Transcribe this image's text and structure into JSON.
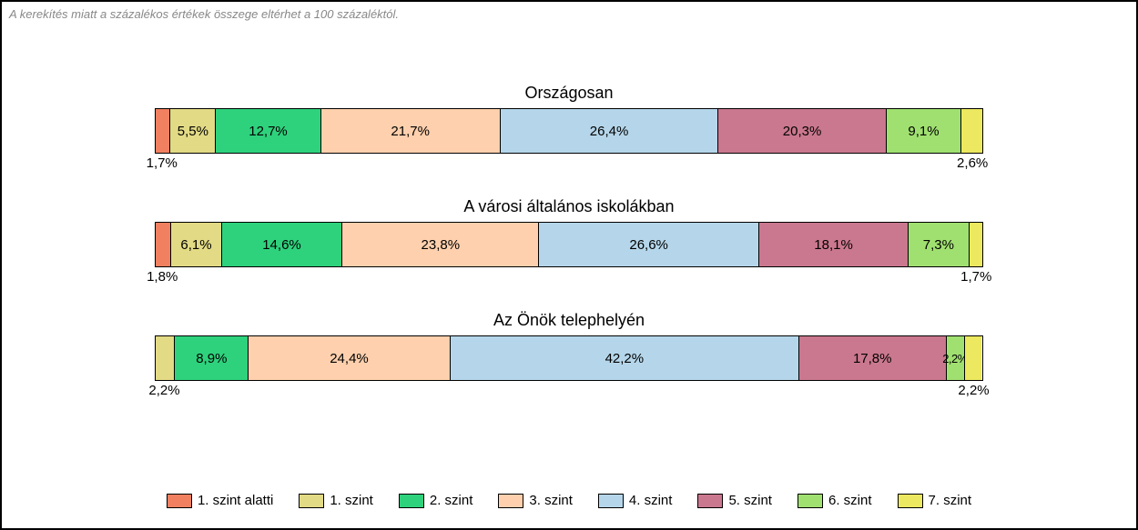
{
  "note": "A kerekítés miatt a százalékos értékek összege eltérhet a 100 százaléktól.",
  "colors": {
    "l0": "#f08060",
    "l1": "#e2da85",
    "l2": "#2ed27d",
    "l3": "#fed0ad",
    "l4": "#b5d6ea",
    "l5": "#ca788f",
    "l6": "#a0e070",
    "l7": "#ece85f"
  },
  "legend": [
    {
      "key": "l0",
      "label": "1. szint alatti"
    },
    {
      "key": "l1",
      "label": "1. szint"
    },
    {
      "key": "l2",
      "label": "2. szint"
    },
    {
      "key": "l3",
      "label": "3. szint"
    },
    {
      "key": "l4",
      "label": "4. szint"
    },
    {
      "key": "l5",
      "label": "5. szint"
    },
    {
      "key": "l6",
      "label": "6. szint"
    },
    {
      "key": "l7",
      "label": "7. szint"
    }
  ],
  "chart_data": [
    {
      "type": "bar",
      "title": "Országosan",
      "segments": [
        {
          "level": "l0",
          "value": 1.7,
          "label": "1,7%",
          "pos": "below-left"
        },
        {
          "level": "l1",
          "value": 5.5,
          "label": "5,5%",
          "pos": "inside"
        },
        {
          "level": "l2",
          "value": 12.7,
          "label": "12,7%",
          "pos": "inside"
        },
        {
          "level": "l3",
          "value": 21.7,
          "label": "21,7%",
          "pos": "inside"
        },
        {
          "level": "l4",
          "value": 26.4,
          "label": "26,4%",
          "pos": "inside"
        },
        {
          "level": "l5",
          "value": 20.3,
          "label": "20,3%",
          "pos": "inside"
        },
        {
          "level": "l6",
          "value": 9.1,
          "label": "9,1%",
          "pos": "inside"
        },
        {
          "level": "l7",
          "value": 2.6,
          "label": "2,6%",
          "pos": "below-right"
        }
      ]
    },
    {
      "type": "bar",
      "title": "A városi általános iskolákban",
      "segments": [
        {
          "level": "l0",
          "value": 1.8,
          "label": "1,8%",
          "pos": "below-left"
        },
        {
          "level": "l1",
          "value": 6.1,
          "label": "6,1%",
          "pos": "inside"
        },
        {
          "level": "l2",
          "value": 14.6,
          "label": "14,6%",
          "pos": "inside"
        },
        {
          "level": "l3",
          "value": 23.8,
          "label": "23,8%",
          "pos": "inside"
        },
        {
          "level": "l4",
          "value": 26.6,
          "label": "26,6%",
          "pos": "inside"
        },
        {
          "level": "l5",
          "value": 18.1,
          "label": "18,1%",
          "pos": "inside"
        },
        {
          "level": "l6",
          "value": 7.3,
          "label": "7,3%",
          "pos": "inside"
        },
        {
          "level": "l7",
          "value": 1.7,
          "label": "1,7%",
          "pos": "below-right"
        }
      ]
    },
    {
      "type": "bar",
      "title": "Az Önök telephelyén",
      "segments": [
        {
          "level": "l0",
          "value": 0.0,
          "label": "",
          "pos": "none"
        },
        {
          "level": "l1",
          "value": 2.2,
          "label": "2,2%",
          "pos": "below-left"
        },
        {
          "level": "l2",
          "value": 8.9,
          "label": "8,9%",
          "pos": "inside"
        },
        {
          "level": "l3",
          "value": 24.4,
          "label": "24,4%",
          "pos": "inside"
        },
        {
          "level": "l4",
          "value": 42.2,
          "label": "42,2%",
          "pos": "inside"
        },
        {
          "level": "l5",
          "value": 17.8,
          "label": "17,8%",
          "pos": "inside"
        },
        {
          "level": "l6",
          "value": 2.2,
          "label": "2,2%",
          "pos": "inside-tight"
        },
        {
          "level": "l7",
          "value": 2.2,
          "label": "2,2%",
          "pos": "below-right"
        }
      ]
    }
  ]
}
